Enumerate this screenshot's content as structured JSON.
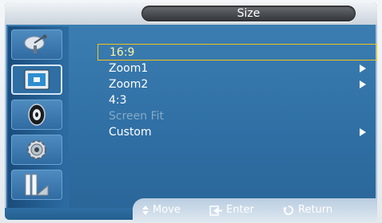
{
  "title": "Size",
  "sidebar": {
    "items": [
      {
        "icon": "satellite-dish-icon"
      },
      {
        "icon": "picture-icon",
        "selected": true
      },
      {
        "icon": "speaker-icon"
      },
      {
        "icon": "gear-icon"
      },
      {
        "icon": "input-icon"
      }
    ]
  },
  "menu": {
    "items": [
      {
        "label": "16:9",
        "state": "selected"
      },
      {
        "label": "Zoom1",
        "submenu": true
      },
      {
        "label": "Zoom2",
        "submenu": true
      },
      {
        "label": "4:3"
      },
      {
        "label": "Screen Fit",
        "state": "disabled"
      },
      {
        "label": "Custom",
        "submenu": true
      }
    ]
  },
  "hints": {
    "move": "Move",
    "enter": "Enter",
    "return": "Return"
  },
  "colors": {
    "selection_border": "#f2c417",
    "panel_blue": "#2f6fa4",
    "disabled_text": "#86a9c6"
  }
}
